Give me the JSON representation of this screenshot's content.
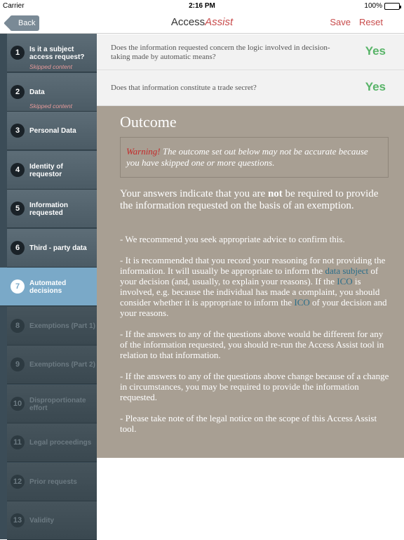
{
  "status": {
    "carrier": "Carrier",
    "time": "2:16 PM",
    "battery": "100%"
  },
  "nav": {
    "back": "Back",
    "title_bold": "Access",
    "title_accent": "Assist",
    "save": "Save",
    "reset": "Reset"
  },
  "sidebar": {
    "items": [
      {
        "num": "1",
        "label": "Is it a subject access request?",
        "sub": "Skipped content"
      },
      {
        "num": "2",
        "label": "Data",
        "sub": "Skipped content"
      },
      {
        "num": "3",
        "label": "Personal Data"
      },
      {
        "num": "4",
        "label": "Identity of requestor"
      },
      {
        "num": "5",
        "label": "Information requested"
      },
      {
        "num": "6",
        "label": "Third - party data"
      },
      {
        "num": "7",
        "label": "Automated decisions"
      },
      {
        "num": "8",
        "label": "Exemptions (Part 1)"
      },
      {
        "num": "9",
        "label": "Exemptions (Part 2)"
      },
      {
        "num": "10",
        "label": "Disproportionate effort"
      },
      {
        "num": "11",
        "label": "Legal proceedings"
      },
      {
        "num": "12",
        "label": "Prior requests"
      },
      {
        "num": "13",
        "label": "Validity"
      }
    ]
  },
  "questions": [
    {
      "text": "Does the information requested concern the logic involved in decision-taking made by automatic means?",
      "answer": "Yes"
    },
    {
      "text": "Does that information constitute a trade secret?",
      "answer": "Yes"
    }
  ],
  "outcome": {
    "heading": "Outcome",
    "warning_label": "Warning!",
    "warning_text": " The outcome set out below may not be accurate because you have skipped one or more questions.",
    "summary_pre": "Your answers indicate that you are ",
    "summary_bold": "not",
    "summary_post": " be required to provide the information requested on the basis of an exemption.",
    "rec1": "- We recommend you seek appropriate advice to confirm this.",
    "rec2_a": "- It is recommended that you record your reasoning for not providing the information. It will usually be appropriate to inform the ",
    "rec2_link1": "data subject",
    "rec2_b": " of your decision (and, usually, to explain your reasons). If the ",
    "rec2_link2": "ICO",
    "rec2_c": " is involved, e.g. because the individual has made a complaint, you should consider whether it is appropriate to inform the ",
    "rec2_link3": "ICO",
    "rec2_d": " of your decision and your reasons.",
    "rec3": "- If the answers to any of the questions above would be different for any of the information requested, you should re-run the Access Assist tool in relation to that information.",
    "rec4": "- If the answers to any of the questions above change because of a change in circumstances, you may be required to provide the information requested.",
    "rec5": "- Please take note of the legal notice on the scope of this Access Assist tool."
  }
}
